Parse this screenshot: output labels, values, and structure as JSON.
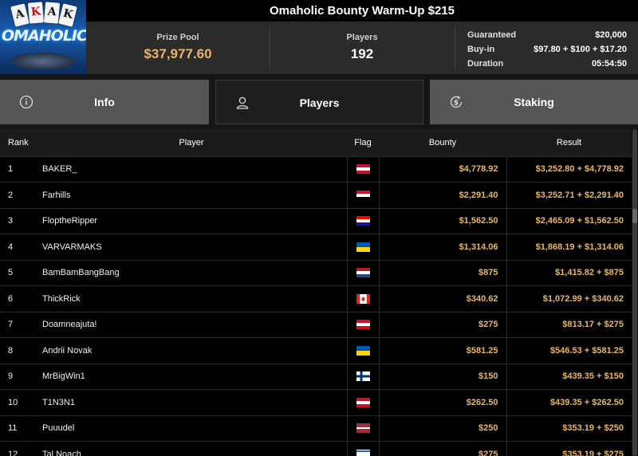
{
  "logo": {
    "cards": [
      "A",
      "K",
      "A",
      "K"
    ],
    "brand": "OMAHOLIC"
  },
  "title": "Omaholic Bounty Warm-Up $215",
  "stats": {
    "prize_pool_label": "Prize Pool",
    "prize_pool_value": "$37,977.60",
    "players_label": "Players",
    "players_value": "192",
    "details": [
      {
        "label": "Guaranteed",
        "value": "$20,000"
      },
      {
        "label": "Buy-in",
        "value": "$97.80 + $100 + $17.20"
      },
      {
        "label": "Duration",
        "value": "05:54:50"
      }
    ]
  },
  "tabs": [
    {
      "label": "Info",
      "icon": "info-icon"
    },
    {
      "label": "Players",
      "icon": "user-icon"
    },
    {
      "label": "Staking",
      "icon": "dollar-cycle-icon"
    }
  ],
  "table": {
    "headers": {
      "rank": "Rank",
      "player": "Player",
      "flag": "Flag",
      "bounty": "Bounty",
      "result": "Result"
    },
    "rows": [
      {
        "rank": "1",
        "player": "BAKER_",
        "flag": "austria",
        "bounty": "$4,778.92",
        "result": "$3,252.80 + $4,778.92"
      },
      {
        "rank": "2",
        "player": "Farhills",
        "flag": "egypt",
        "bounty": "$2,291.40",
        "result": "$3,252.71 + $2,291.40"
      },
      {
        "rank": "3",
        "player": "FloptheRipper",
        "flag": "croatia",
        "bounty": "$1,562.50",
        "result": "$2,465.09 + $1,562.50"
      },
      {
        "rank": "4",
        "player": "VARVARMAKS",
        "flag": "ukraine",
        "bounty": "$1,314.06",
        "result": "$1,868.19 + $1,314.06"
      },
      {
        "rank": "5",
        "player": "BamBamBangBang",
        "flag": "netherlands",
        "bounty": "$875",
        "result": "$1,415.82 + $875"
      },
      {
        "rank": "6",
        "player": "ThickRick",
        "flag": "canada",
        "bounty": "$340.62",
        "result": "$1,072.99 + $340.62"
      },
      {
        "rank": "7",
        "player": "Doamneajuta!",
        "flag": "austria",
        "bounty": "$275",
        "result": "$813.17 + $275"
      },
      {
        "rank": "8",
        "player": "Andrii Novak",
        "flag": "ukraine",
        "bounty": "$581.25",
        "result": "$546.53 + $581.25"
      },
      {
        "rank": "9",
        "player": "MrBigWin1",
        "flag": "finland",
        "bounty": "$150",
        "result": "$439.35 + $150"
      },
      {
        "rank": "10",
        "player": "T1N3N1",
        "flag": "austria",
        "bounty": "$262.50",
        "result": "$439.35 + $262.50"
      },
      {
        "rank": "11",
        "player": "Puuudel",
        "flag": "latvia",
        "bounty": "$250",
        "result": "$353.19 + $250"
      },
      {
        "rank": "12",
        "player": "Tal Noach",
        "flag": "israel",
        "bounty": "$275",
        "result": "$353.19 + $275"
      }
    ]
  },
  "colors": {
    "accent_gold": "#e8b66a",
    "header_bg": "#2b2b2b",
    "tab_bg": "#555555",
    "tab_active_bg": "#1e1e1e"
  }
}
